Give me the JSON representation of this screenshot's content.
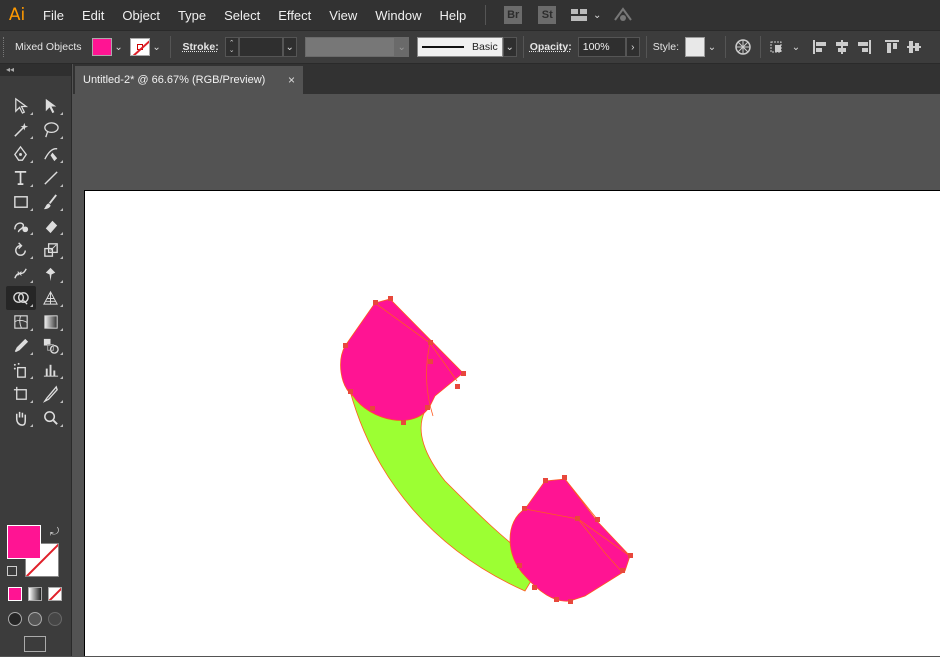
{
  "app": {
    "logo": "Ai"
  },
  "menu": [
    "File",
    "Edit",
    "Object",
    "Type",
    "Select",
    "Effect",
    "View",
    "Window",
    "Help"
  ],
  "bridge_badges": [
    "Br",
    "St"
  ],
  "control": {
    "selection": "Mixed Objects",
    "stroke_label": "Stroke:",
    "stroke_style": "Basic",
    "opacity_label": "Opacity:",
    "opacity_value": "100%",
    "style_label": "Style:"
  },
  "document": {
    "tab_title": "Untitled-2* @ 66.67% (RGB/Preview)",
    "close": "×"
  },
  "colors": {
    "fill": "#ff1493",
    "green": "#9cff33",
    "anchor": "#e8473c",
    "path": "#ff5a1f"
  },
  "tools": [
    [
      "selection-tool-icon",
      "direct-selection-tool-icon"
    ],
    [
      "magic-wand-icon",
      "lasso-tool-icon"
    ],
    [
      "pen-tool-icon",
      "curvature-tool-icon"
    ],
    [
      "type-tool-icon",
      "line-segment-tool-icon"
    ],
    [
      "rectangle-tool-icon",
      "paintbrush-tool-icon"
    ],
    [
      "shaper-tool-icon",
      "eraser-tool-icon"
    ],
    [
      "rotate-tool-icon",
      "scale-tool-icon"
    ],
    [
      "width-tool-icon",
      "puppet-warp-tool-icon"
    ],
    [
      "shape-builder-tool-icon",
      "perspective-grid-tool-icon"
    ],
    [
      "mesh-tool-icon",
      "gradient-tool-icon"
    ],
    [
      "eyedropper-tool-icon",
      "blend-tool-icon"
    ],
    [
      "symbol-sprayer-tool-icon",
      "column-graph-tool-icon"
    ],
    [
      "artboard-tool-icon",
      "slice-tool-icon"
    ],
    [
      "hand-tool-icon",
      "zoom-tool-icon"
    ]
  ]
}
